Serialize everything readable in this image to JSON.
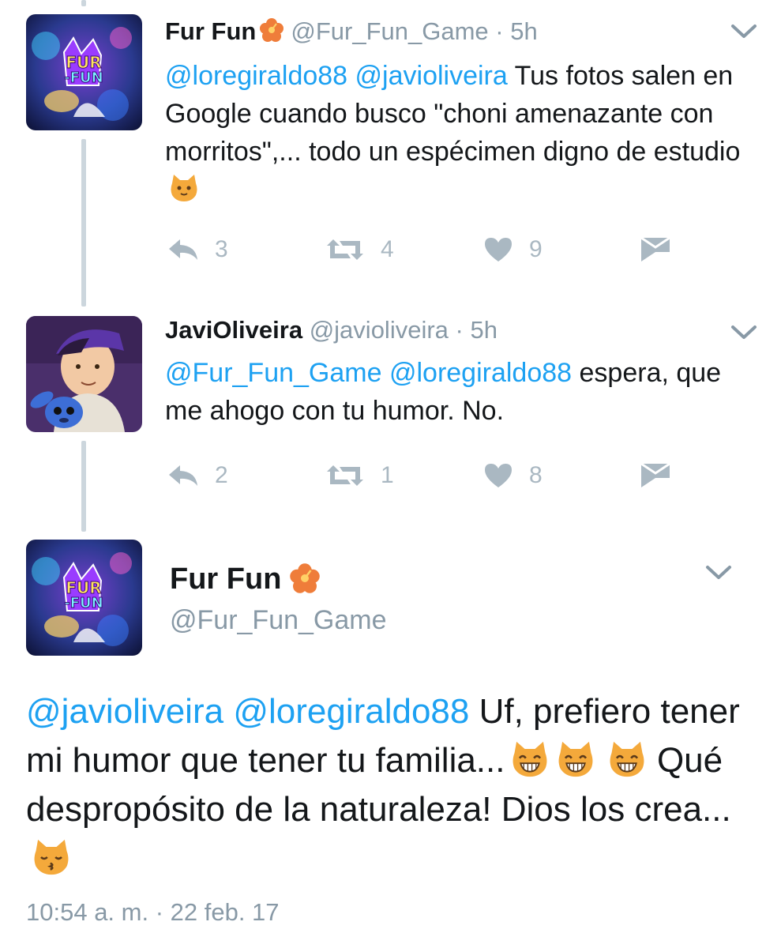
{
  "colors": {
    "mention": "#1da1f2",
    "secondary": "#8899a6",
    "action": "#aab8c2",
    "thread_line": "#ccd6dd"
  },
  "tweets": [
    {
      "name": "Fur Fun",
      "handle": "@Fur_Fun_Game",
      "separator": "·",
      "time": "5h",
      "badge_icon": "hibiscus-icon",
      "mention_1": "@loregiraldo88",
      "mention_2": "@javioliveira",
      "text": "Tus fotos salen en Google cuando busco \"choni amenazante con morritos\",... todo un espécimen digno de estudio",
      "emoji_icon": "cat-face-icon",
      "replies": "3",
      "retweets": "4",
      "likes": "9"
    },
    {
      "name": "JaviOliveira",
      "handle": "@javioliveira",
      "separator": "·",
      "time": "5h",
      "mention_1": "@Fur_Fun_Game",
      "mention_2": "@loregiraldo88",
      "text": "espera, que me ahogo con tu humor. No.",
      "replies": "2",
      "retweets": "1",
      "likes": "8"
    }
  ],
  "main_tweet": {
    "name": "Fur Fun",
    "handle": "@Fur_Fun_Game",
    "badge_icon": "hibiscus-icon",
    "mention_1": "@javioliveira",
    "mention_2": "@loregiraldo88",
    "text_1": "Uf, prefiero tener mi humor que tener tu familia...",
    "text_2": "Qué despropósito de la naturaleza! Dios los crea...",
    "emoji_icons": [
      "grinning-cat-icon",
      "grinning-cat-icon",
      "grinning-cat-icon",
      "kissing-cat-icon"
    ],
    "timestamp": "10:54 a. m. · 22 feb. 17"
  }
}
